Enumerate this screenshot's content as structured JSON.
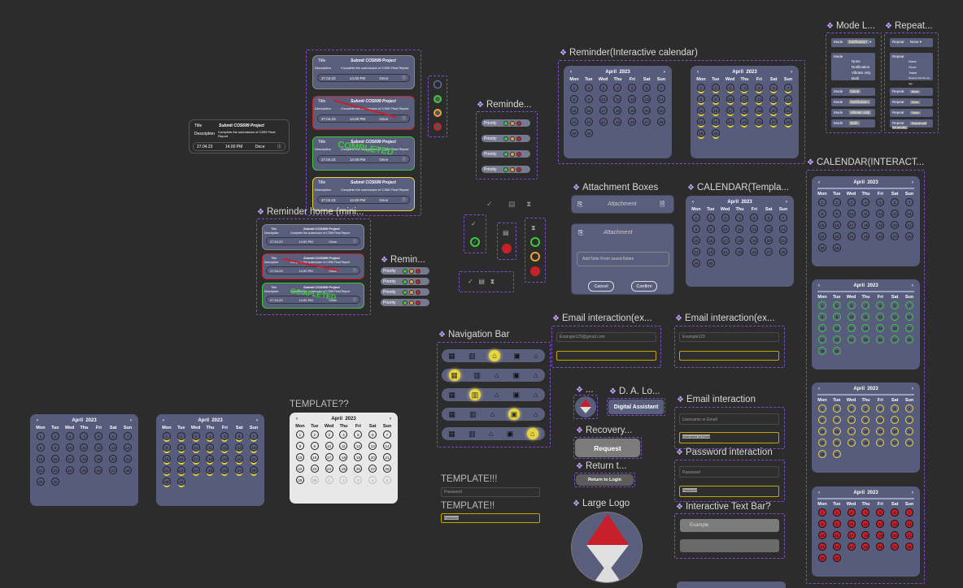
{
  "labels": {
    "mode": "Mode L...",
    "repeat": "Repeat...",
    "rem_cal": "Reminder(Interactive calendar)",
    "reminde": "Reminde...",
    "rem_home": "Reminder home (mini...",
    "remin": "Remin...",
    "attach": "Attachment Boxes",
    "cal_templ": "CALENDAR(Templa...",
    "cal_inter": "CALENDAR(INTERACT...",
    "email1": "Email interaction(ex...",
    "email2": "Email interaction(ex...",
    "navbar": "Navigation Bar",
    "da": "D. A. Lo...",
    "recovery": "Recovery...",
    "returnt": "Return t...",
    "email3": "Email interaction",
    "password": "Password interaction",
    "large_logo": "Large Logo",
    "textbar": "Interactive Text Bar?",
    "templ1": "TEMPLATE??",
    "templ2": "TEMPLATE!!!",
    "templ3": "TEMPLATE!!",
    "dots": "..."
  },
  "task": {
    "title": "Title",
    "title_val": "Submit COS699 Project",
    "desc": "Description",
    "desc_val": "Complete the submission of CS99 Final Report",
    "date": "27.04.23",
    "time": "14.00 PM",
    "rep": "Once",
    "completed": "COMPLETED"
  },
  "calendar": {
    "month": "April",
    "year": "2023",
    "days": [
      "Mon",
      "Tue",
      "Wed",
      "Thu",
      "Fri",
      "Sat",
      "Sun"
    ]
  },
  "mode": {
    "mode": "Mode",
    "opts": [
      "Notification",
      "Vibrate only",
      "Both"
    ],
    "none": "None",
    "sel": "Notification"
  },
  "repeat": {
    "repeat": "Repeat",
    "opts": [
      "Once",
      "Twice",
      "Repeat until the set day"
    ],
    "none": "None"
  },
  "priority": "Priority",
  "attach": {
    "attachment": "Attachment",
    "note": "Add Note From saved Notes",
    "cancel": "Cancel",
    "confirm": "Confirm"
  },
  "email": {
    "ph": "Example123@gmail.com",
    "ph2": "Example123",
    "ph3": "Username or Email",
    "ph4": "Username or Email"
  },
  "password": "Password",
  "textbar": "Example",
  "da_label": "Digital Assistant",
  "request": "Request",
  "return_login": "Return to Login",
  "colors": {
    "bg": "#2c2c2c",
    "card": "#5a5e7d",
    "accent": "#c7a6ff",
    "green": "#3cc93c",
    "yellow": "#e6d43a",
    "red": "#c8202a"
  }
}
